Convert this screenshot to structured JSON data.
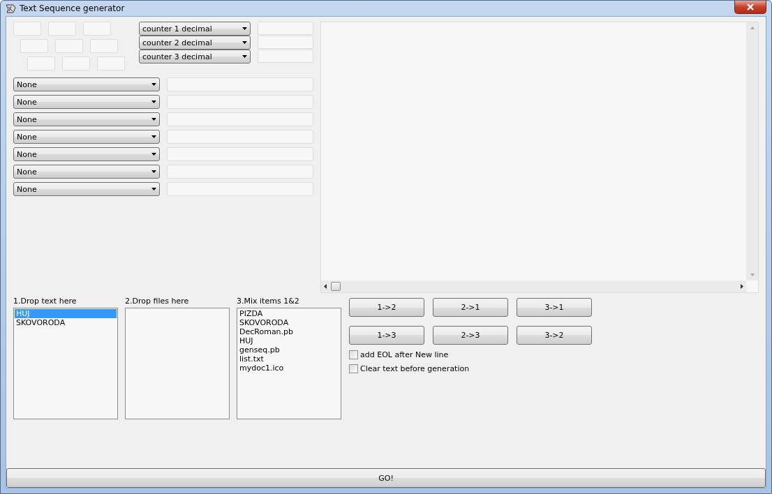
{
  "window": {
    "title": "Text Sequence generator"
  },
  "counters": [
    {
      "value": "counter 1 decimal"
    },
    {
      "value": "counter 2 decimal"
    },
    {
      "value": "counter 3 decimal"
    }
  ],
  "rows": [
    {
      "value": "None"
    },
    {
      "value": "None"
    },
    {
      "value": "None"
    },
    {
      "value": "None"
    },
    {
      "value": "None"
    },
    {
      "value": "None"
    },
    {
      "value": "None"
    }
  ],
  "lists": [
    {
      "label": "1.Drop text here",
      "items": [
        {
          "text": "HUJ",
          "selected": true
        },
        {
          "text": "SKOVORODA",
          "selected": false
        }
      ]
    },
    {
      "label": "2.Drop files here"
    },
    {
      "label": "3.Mix items 1&2",
      "items": [
        {
          "text": "PIZDA",
          "selected": false
        },
        {
          "text": "SKOVORODA",
          "selected": false
        },
        {
          "text": "DecRoman.pb",
          "selected": false
        },
        {
          "text": "HUJ",
          "selected": false
        },
        {
          "text": "genseq.pb",
          "selected": false
        },
        {
          "text": "list.txt",
          "selected": false
        },
        {
          "text": "mydoc1.ico",
          "selected": false
        }
      ]
    }
  ],
  "transfer_buttons": [
    "1->2",
    "2->1",
    "3->1",
    "1->3",
    "2->3",
    "3->2"
  ],
  "options": [
    {
      "label": "add EOL after New line",
      "checked": false
    },
    {
      "label": "Clear text before generation",
      "checked": false
    }
  ],
  "go_button": "GO!"
}
